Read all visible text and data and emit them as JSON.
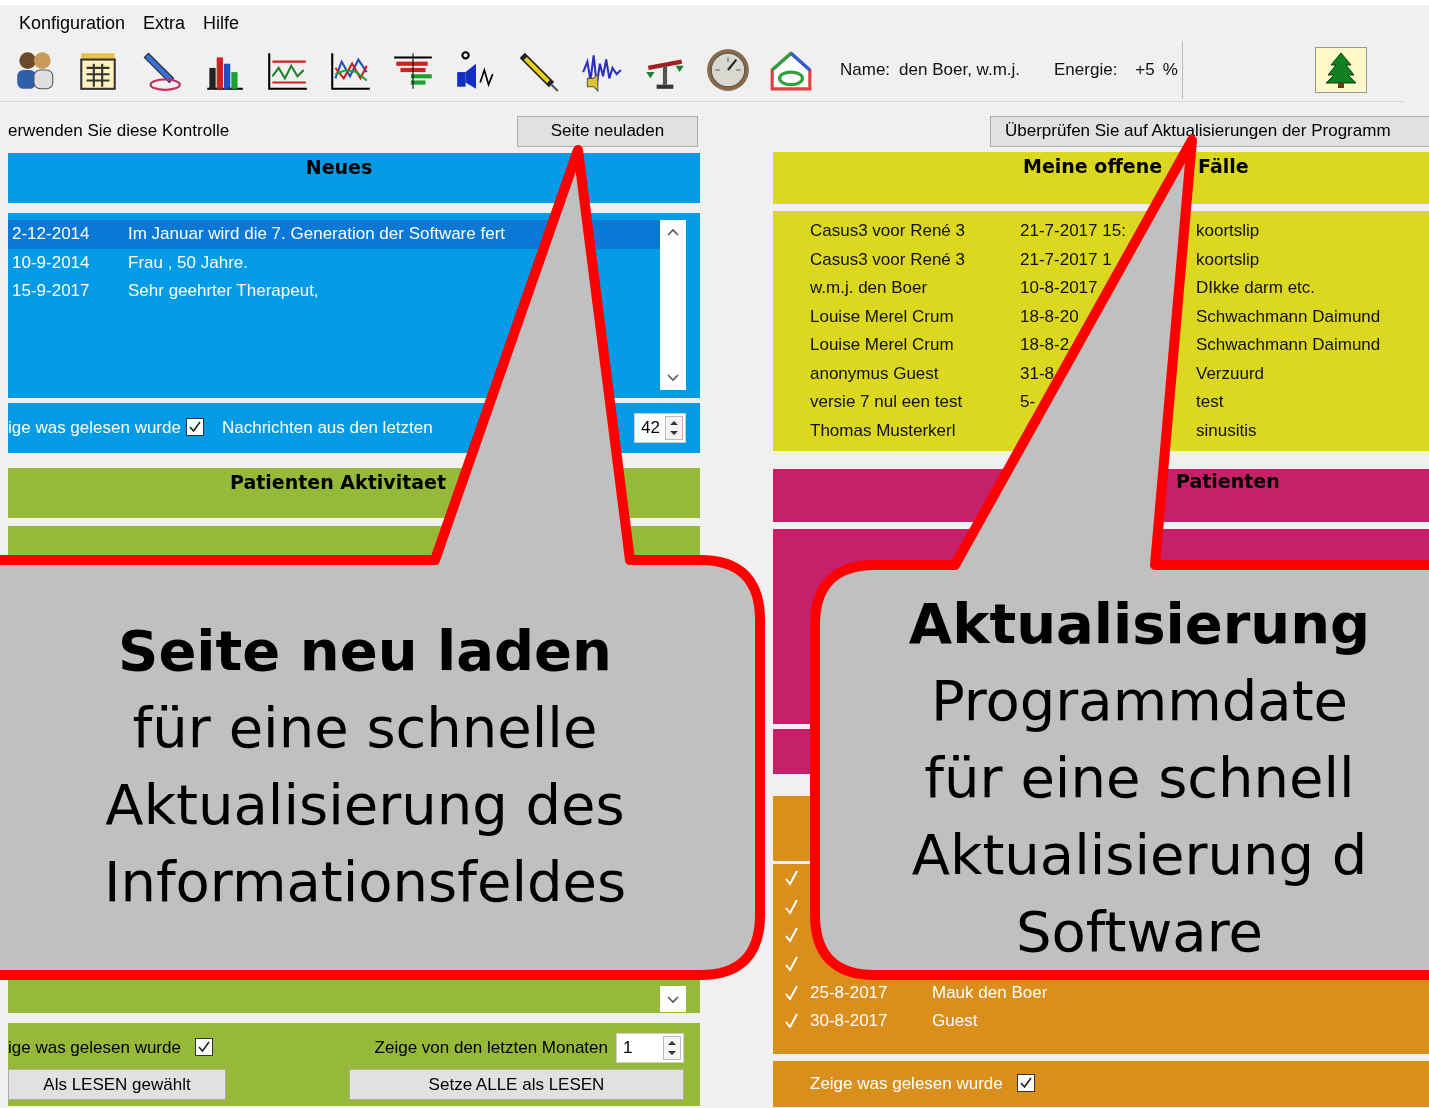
{
  "menu": [
    {
      "label": "Konfiguration"
    },
    {
      "label": "Extra"
    },
    {
      "label": "Hilfe"
    }
  ],
  "toolbar": {
    "name_label": "Name:",
    "name_value": "den Boer, w.m.j.",
    "energy_label": "Energie:",
    "energy_value": "+5",
    "energy_unit": "%"
  },
  "hint": "erwenden Sie diese Kontrolle",
  "reload_button": "Seite neuladen",
  "update_button": "Überprüfen Sie auf Aktualisierungen der Programm",
  "news": {
    "title": "Neues",
    "rows": [
      {
        "date": "2-12-2014",
        "text": "Im Januar wird die 7. Generation der Software fert",
        "selected": true
      },
      {
        "date": "10-9-2014",
        "text": "Frau , 50 Jahre.",
        "selected": false
      },
      {
        "date": "15-9-2017",
        "text": "Sehr geehrter Therapeut,",
        "selected": false
      }
    ],
    "show_read": {
      "label": "ige was gelesen wurde",
      "checked": true
    },
    "recent_label": "Nachrichten aus den letzten",
    "months": "42"
  },
  "activity": {
    "title": "Patienten Aktivitaet",
    "show_read": {
      "label": "ige was gelesen wurde",
      "checked": true
    },
    "months_label": "Zeige von den letzten Monaten",
    "months": "1",
    "buttons": [
      "Als LESEN gewählt",
      "Setze ALLE als LESEN"
    ]
  },
  "cases": {
    "title_parts": [
      "Meine offene",
      "Fälle"
    ],
    "rows": [
      {
        "name": "Casus3 voor René 3",
        "date": "21-7-2017 15:",
        "diagnosis": "koortslip"
      },
      {
        "name": "Casus3 voor René 3",
        "date": "21-7-2017 1",
        "diagnosis": "koortslip"
      },
      {
        "name": "w.m.j. den Boer",
        "date": "10-8-2017",
        "diagnosis": "DIkke darm etc."
      },
      {
        "name": "Louise Merel Crum",
        "date": "18-8-20",
        "diagnosis": "Schwachmann Daimund"
      },
      {
        "name": "Louise Merel Crum",
        "date": "18-8-2",
        "diagnosis": "Schwachmann Daimund"
      },
      {
        "name": "anonymus Guest",
        "date": "31-8",
        "diagnosis": "Verzuurd"
      },
      {
        "name": "versie 7 nul een test",
        "date": "5-",
        "diagnosis": "test"
      },
      {
        "name": "Thomas Musterkerl",
        "diagnosis": "sinusitis"
      }
    ]
  },
  "patients": {
    "title": "Patienten"
  },
  "visits": {
    "rows": [
      {
        "read": true
      },
      {
        "read": true
      },
      {
        "read": true
      },
      {
        "read": true
      },
      {
        "date": "25-8-2017",
        "name": "Mauk den Boer",
        "read": true
      },
      {
        "date": "30-8-2017",
        "name": "Guest",
        "read": true
      }
    ],
    "show_read": {
      "label": "Zeige was gelesen wurde",
      "checked": true
    }
  },
  "callouts": [
    {
      "lines": [
        "Seite neu laden",
        "für eine schnelle",
        "Aktualisierung des",
        "Informationsfeldes"
      ]
    },
    {
      "lines": [
        "Aktualisierung",
        "Programmdate",
        "für eine schnell",
        "Aktualisierung d",
        "Software"
      ]
    }
  ]
}
